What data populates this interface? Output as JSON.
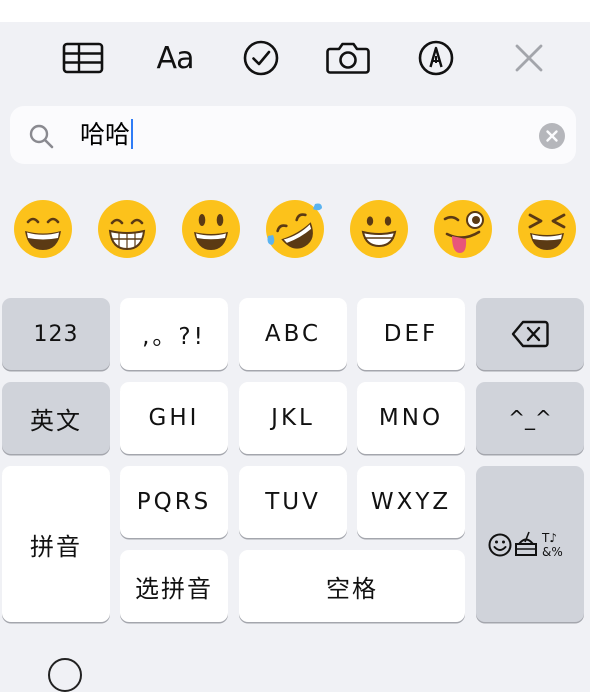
{
  "toolbar": {
    "format_label": "Aa",
    "icons": [
      "table-icon",
      "text-format-icon",
      "checklist-icon",
      "camera-icon",
      "markup-pen-icon",
      "close-icon"
    ]
  },
  "search": {
    "value": "哈哈"
  },
  "emoji_suggestions": [
    {
      "name": "grinning-smiling-eyes-emoji"
    },
    {
      "name": "beaming-face-emoji"
    },
    {
      "name": "grinning-face-big-eyes-emoji"
    },
    {
      "name": "rolling-on-floor-laughing-emoji"
    },
    {
      "name": "grinning-face-emoji"
    },
    {
      "name": "winking-tongue-emoji"
    },
    {
      "name": "squinting-face-emoji"
    }
  ],
  "keyboard": {
    "numbers_key": "123",
    "punct_key": ",。?!",
    "abc_key": "ABC",
    "def_key": "DEF",
    "delete_icon": "delete-icon",
    "english_key": "英文",
    "ghi_key": "GHI",
    "jkl_key": "JKL",
    "mno_key": "MNO",
    "emoticon_key": "^_^",
    "pinyin_key": "拼音",
    "pqrs_key": "PQRS",
    "tuv_key": "TUV",
    "wxyz_key": "WXYZ",
    "select_pinyin_key": "选拼音",
    "space_key": "空格",
    "symbols_key_icons": [
      "smiley-icon",
      "food-icon",
      "symbols-icon"
    ]
  }
}
